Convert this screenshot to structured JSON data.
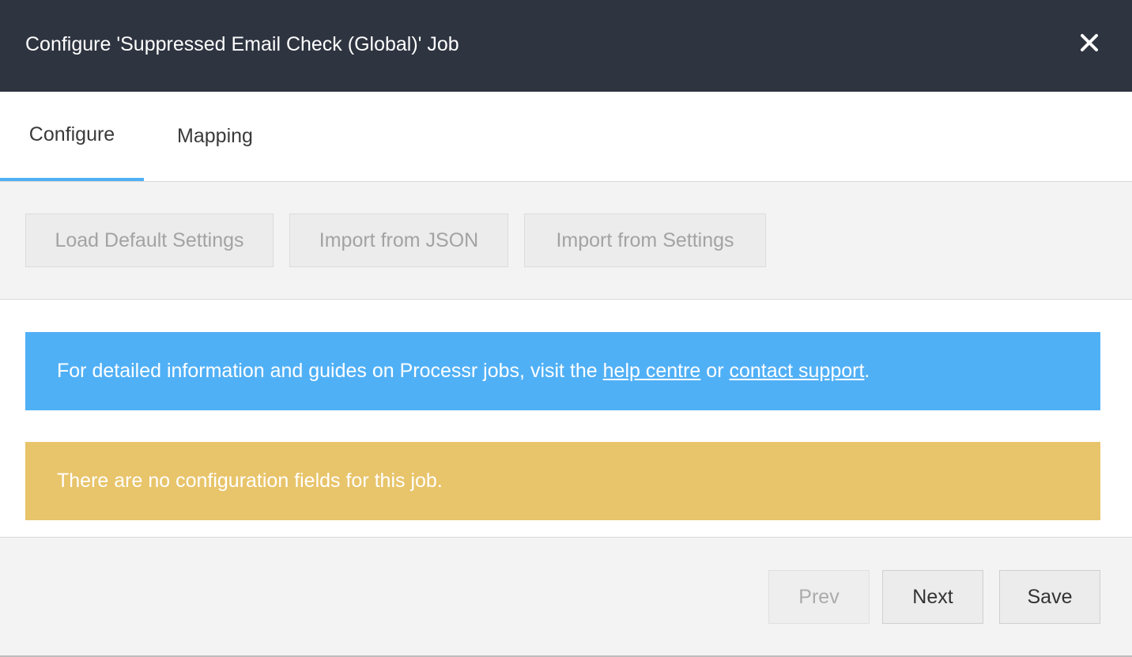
{
  "dialog": {
    "title": "Configure 'Suppressed Email Check (Global)' Job",
    "close_icon": "close-icon"
  },
  "tabs": [
    {
      "label": "Configure",
      "active": true
    },
    {
      "label": "Mapping",
      "active": false
    }
  ],
  "toolbar": {
    "load_default": "Load Default Settings",
    "import_json": "Import from JSON",
    "import_settings": "Import from Settings"
  },
  "info_banner": {
    "text_before": "For detailed information and guides on Processr jobs, visit the ",
    "help_link": "help centre",
    "text_middle": " or ",
    "support_link": "contact support",
    "text_after": ".",
    "color": "#50b0f6"
  },
  "warning_banner": {
    "text": "There are no configuration fields for this job.",
    "color": "#e8c46a"
  },
  "footer": {
    "prev": "Prev",
    "next": "Next",
    "save": "Save"
  },
  "colors": {
    "header_bg": "#2e3440",
    "tab_accent": "#4fb0f5"
  }
}
